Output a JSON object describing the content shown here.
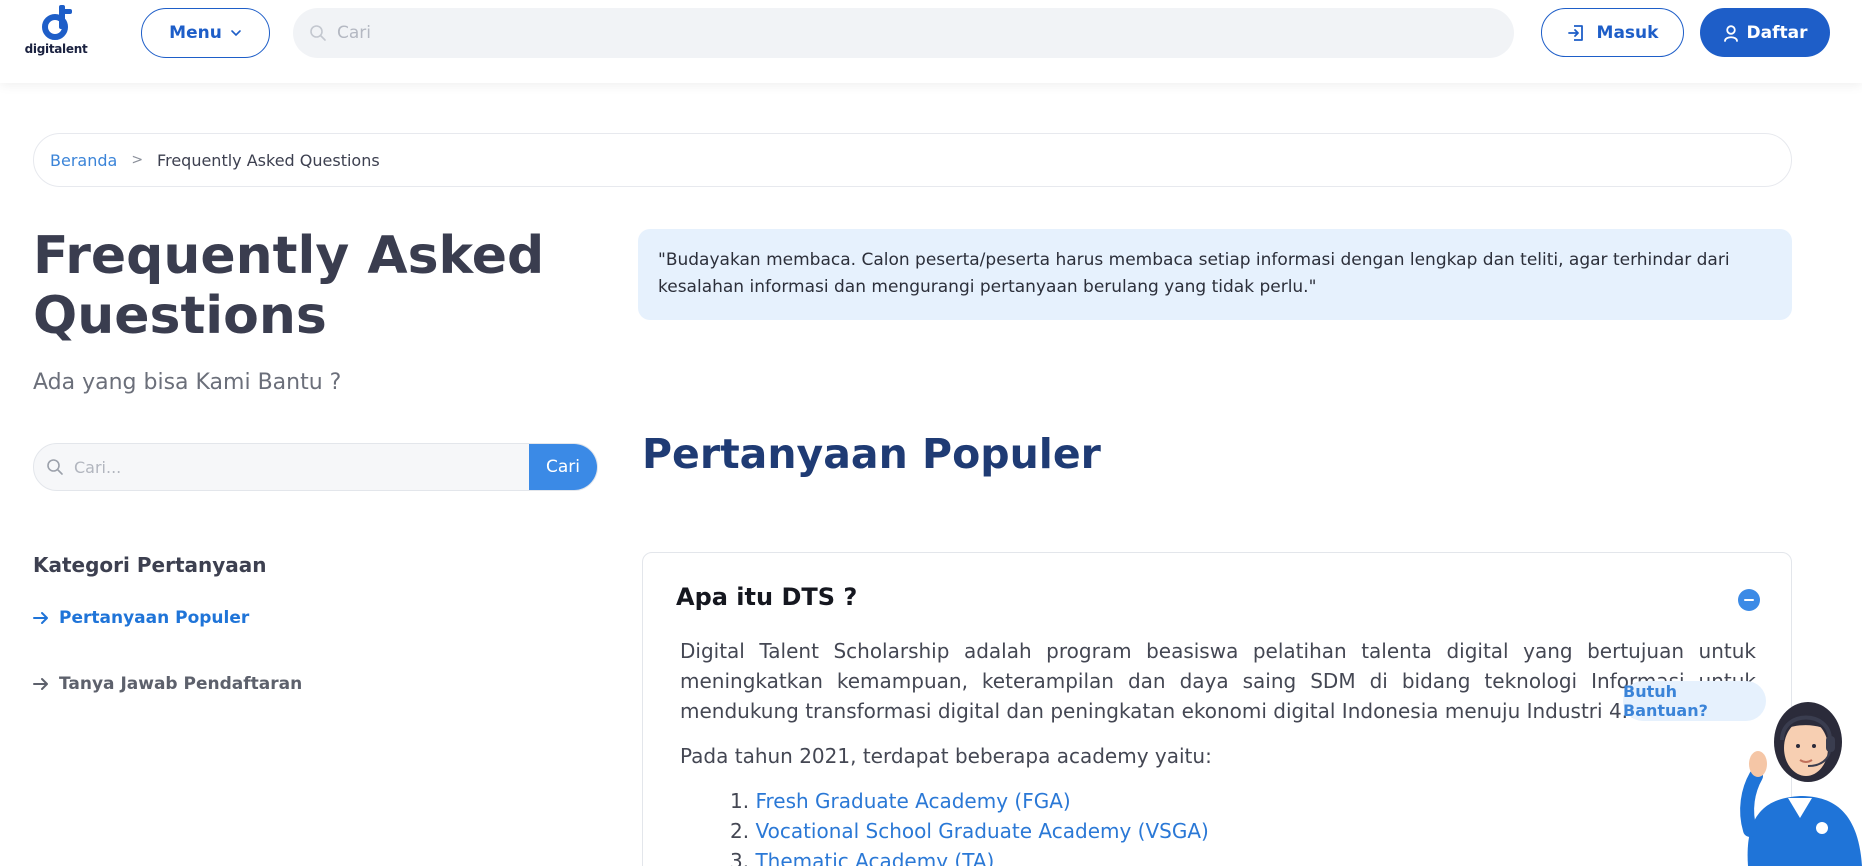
{
  "header": {
    "logo_text": "digitalent",
    "menu_label": "Menu",
    "search_placeholder": "Cari",
    "login_label": "Masuk",
    "register_label": "Daftar"
  },
  "breadcrumb": {
    "home": "Beranda",
    "separator": ">",
    "current": "Frequently Asked Questions"
  },
  "left": {
    "title": "Frequently Asked Questions",
    "subtitle": "Ada yang bisa Kami Bantu ?",
    "search_placeholder": "Cari...",
    "search_button": "Cari",
    "category_title": "Kategori Pertanyaan",
    "categories": [
      {
        "label": "Pertanyaan Populer",
        "active": true
      },
      {
        "label": "Tanya Jawab Pendaftaran",
        "active": false
      }
    ]
  },
  "notice": "\"Budayakan membaca. Calon peserta/peserta harus membaca setiap informasi dengan lengkap dan teliti, agar terhindar dari kesalahan informasi dan mengurangi pertanyaan berulang yang tidak perlu.\"",
  "section_title": "Pertanyaan Populer",
  "faq": {
    "question": "Apa itu DTS ?",
    "paragraph_1": "Digital Talent Scholarship adalah program beasiswa pelatihan talenta digital yang bertujuan untuk meningkatkan kemampuan, keterampilan dan daya saing SDM di bidang teknologi Informasi untuk mendukung transformasi digital dan peningkatan ekonomi digital Indonesia menuju Industri 4.0.",
    "paragraph_2": "Pada tahun 2021, terdapat beberapa academy yaitu:",
    "academies": [
      {
        "num": "1.",
        "label": "Fresh Graduate Academy (FGA)"
      },
      {
        "num": "2.",
        "label": "Vocational School Graduate Academy (VSGA)"
      },
      {
        "num": "3.",
        "label": "Thematic Academy (TA)"
      }
    ]
  },
  "help": {
    "bubble": "Butuh Bantuan?"
  },
  "colors": {
    "primary": "#1e5ec8",
    "accent": "#3b8ae6",
    "title_dark": "#1f3b74",
    "notice_bg": "#e6f1fd"
  },
  "icons": [
    "digitalent-logo",
    "chevron-down-icon",
    "search-icon",
    "login-icon",
    "user-icon",
    "arrow-right-icon",
    "minus-circle-icon"
  ]
}
